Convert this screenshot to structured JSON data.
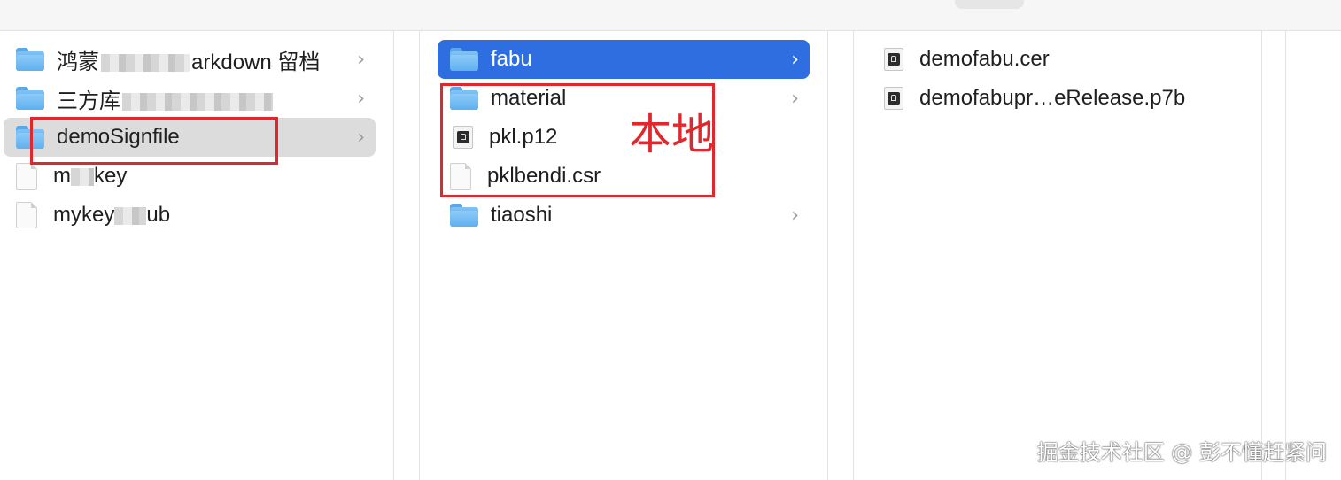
{
  "columns": {
    "col1": [
      {
        "label": "鸿蒙",
        "label_tail": "arkdown 留档",
        "type": "folder",
        "has_children": true
      },
      {
        "label": "三方库",
        "label_tail": "",
        "type": "folder",
        "has_children": true
      },
      {
        "label": "demoSignfile",
        "type": "folder",
        "has_children": true,
        "selected": true
      },
      {
        "label": "m",
        "label_tail": "key",
        "type": "file"
      },
      {
        "label": "mykey",
        "label_tail": "ub",
        "type": "file"
      }
    ],
    "col2": [
      {
        "label": "fabu",
        "type": "folder",
        "has_children": true,
        "selected": true
      },
      {
        "label": "material",
        "type": "folder",
        "has_children": true
      },
      {
        "label": "pkl.p12",
        "type": "cert"
      },
      {
        "label": "pklbendi.csr",
        "type": "file"
      },
      {
        "label": "tiaoshi",
        "type": "folder",
        "has_children": true
      }
    ],
    "col3": [
      {
        "label": "demofabu.cer",
        "type": "cert"
      },
      {
        "label": "demofabupr…eRelease.p7b",
        "type": "cert"
      }
    ]
  },
  "chevron": "›",
  "annotation_text": "本地",
  "watermark": "掘金技术社区 @ 彭不懂赶紧问",
  "colors": {
    "selection_blue": "#2f6ee0",
    "selection_gray": "#dcdcdc",
    "annotation_red": "#e0272d"
  }
}
